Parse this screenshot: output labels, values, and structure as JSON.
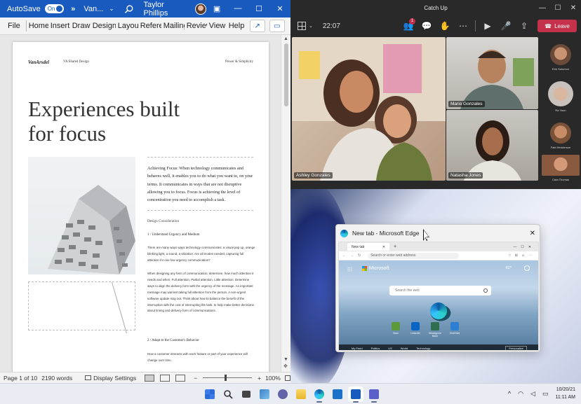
{
  "word": {
    "autosave_label": "AutoSave",
    "toggle_state": "On",
    "more_glyph": "»",
    "doc_name": "Van...",
    "user_name": "Taylor Phillips",
    "ribbon_tabs": [
      "File",
      "Home",
      "Insert",
      "Draw",
      "Design",
      "Layout",
      "References",
      "Mailings",
      "Review",
      "View",
      "Help"
    ],
    "document": {
      "logo_text": "VanArsdel",
      "header_sub": "VA Shared Design",
      "header_right": "Power & Simplicity",
      "headline": "Experiences built for focus",
      "intro": "Achieving Focus: When technology communicates and behaves well, it enables you to do what you want to, on your terms. It communicates in ways that are not disruptive allowing you to focus. Focus is achieving the level of concentration you need to accomplish a task.",
      "section_title": "Design Consideration",
      "h1": "1 / Understand Urgency and Medium",
      "p1": "There are many ways ways technology communicates: a visual pop up, orange blinking light, a sound, a vibration. Are all modes needed, capturing full attention for one low urgency communication?",
      "p2": "When designing any form of communication, determine, how much attention it needs and when: Full attention, Partial attention, Little attention. Determine ways to align the delivery form with the urgency of the message. An important message may warrant taking full attention from the person. A non-urgent software update may not. Think about how to balance the benefit of the interruption with the cost of interrupting the task, to help make better decisions about timing and delivery form of communications.",
      "h2": "2 / Adapt to the Customer's Behavior",
      "p3": "How a customer interacts with each feature or part of your experience will change over time."
    },
    "status": {
      "page": "Page 1 of 10",
      "words": "2190 words",
      "display_settings": "Display Settings",
      "zoom_minus": "−",
      "zoom_plus": "+",
      "zoom": "100%",
      "zoom_level_pct": 100
    }
  },
  "teams": {
    "title": "Catch Up",
    "elapsed": "22:07",
    "badge": "1",
    "leave_label": "Leave",
    "participants": [
      {
        "name": "Ashley Gonzales"
      },
      {
        "name": "Mario Gonzales"
      },
      {
        "name": "Natasha Jones"
      }
    ],
    "sidebar": [
      {
        "name": "Erin Solomon",
        "color": "#6b4a3a"
      },
      {
        "name": "Ra Yoon",
        "color": "#c9c2bc"
      },
      {
        "name": "Fabi Henderson",
        "color": "#7a5238"
      },
      {
        "name": "Cara Thomas",
        "color": "#8a5a40"
      }
    ],
    "colors": {
      "leave": "#c4314b",
      "background": "#292929"
    }
  },
  "edge": {
    "window_title": "New tab - Microsoft Edge",
    "tab_label": "New tab",
    "address_placeholder": "Search or enter web address",
    "brand": "Microsoft",
    "weather": "62°",
    "search_placeholder": "Search the web",
    "quick_links": [
      "Xbox",
      "LinkedIn",
      "Woodgrove Bank",
      "OneDrive"
    ],
    "feed_items": [
      "My Feed",
      "Politics",
      "US",
      "World",
      "Technology"
    ],
    "personalize": "Personalize"
  },
  "taskbar": {
    "apps": [
      {
        "name": "start",
        "color": "#2d6bd8"
      },
      {
        "name": "search",
        "color": "#333333"
      },
      {
        "name": "task-view",
        "color": "#444444"
      },
      {
        "name": "widgets",
        "color": "#3b82c4"
      },
      {
        "name": "teams-chat",
        "color": "#6264a7"
      },
      {
        "name": "file-explorer",
        "color": "#f4c542"
      },
      {
        "name": "edge",
        "color": "#1c8be0"
      },
      {
        "name": "store",
        "color": "#1a73c8"
      },
      {
        "name": "word",
        "color": "#185abd"
      },
      {
        "name": "teams",
        "color": "#5b5fc7"
      }
    ],
    "tray_chevron": "^",
    "date": "10/20/21",
    "time": "11:11 AM"
  }
}
